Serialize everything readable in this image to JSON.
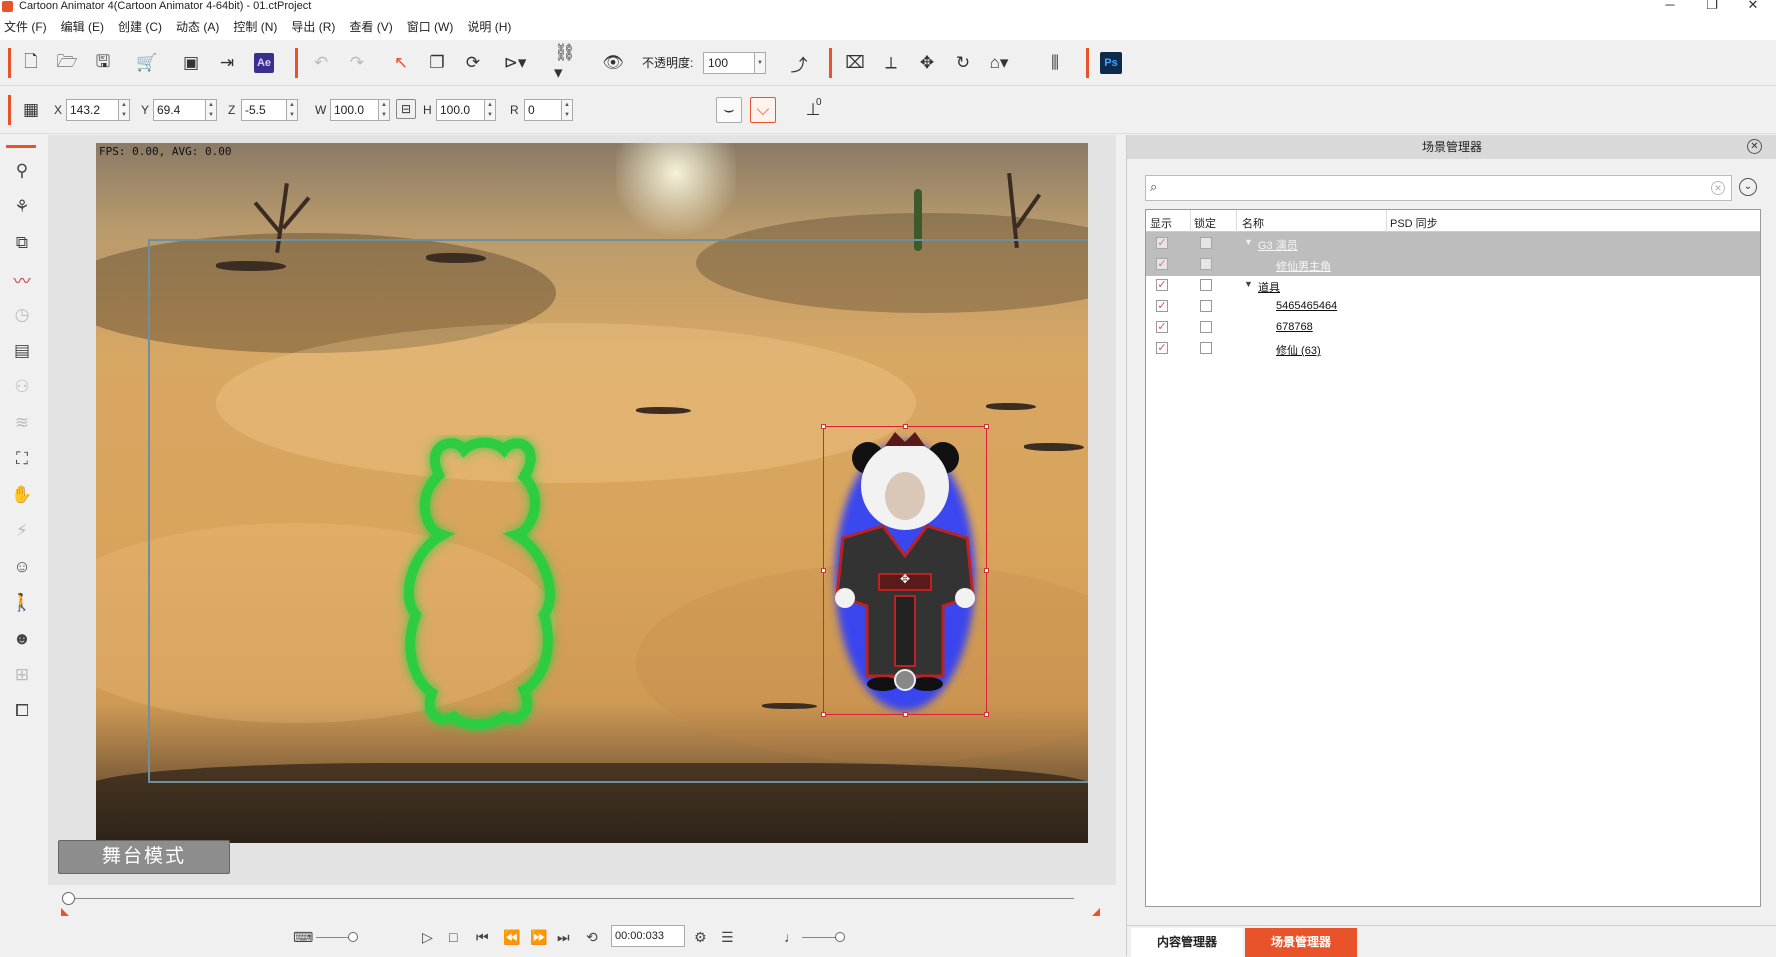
{
  "window": {
    "title": "Cartoon Animator 4(Cartoon Animator 4-64bit) - 01.ctProject",
    "minimize_glyph": "─",
    "restore_glyph": "❐",
    "close_glyph": "✕"
  },
  "menu": [
    "文件 (F)",
    "编辑 (E)",
    "创建 (C)",
    "动态 (A)",
    "控制 (N)",
    "导出 (R)",
    "查看 (V)",
    "窗口 (W)",
    "说明 (H)"
  ],
  "toolbar1": {
    "opacity_label": "不透明度:",
    "opacity_value": "100",
    "ae_label": "Ae",
    "ps_label": "Ps"
  },
  "transform": {
    "x_label": "X",
    "x_value": "143.2",
    "y_label": "Y",
    "y_value": "69.4",
    "z_label": "Z",
    "z_value": "-5.5",
    "w_label": "W",
    "w_value": "100.0",
    "h_label": "H",
    "h_value": "100.0",
    "r_label": "R",
    "r_value": "0",
    "pin_value": "0"
  },
  "viewport": {
    "fps_text": "FPS: 0.00, AVG: 0.00",
    "stage_mode_label": "舞台模式"
  },
  "timeline": {
    "timecode": "00:00:033"
  },
  "scene_manager": {
    "title": "场景管理器",
    "search_placeholder": "",
    "columns": {
      "show": "显示",
      "lock": "锁定",
      "name": "名称",
      "psd": "PSD 同步"
    },
    "rows": [
      {
        "name": "G3 演员",
        "show": true,
        "lock": false,
        "expanded": true,
        "indent": 0,
        "selected": true
      },
      {
        "name": "修仙男主角",
        "show": true,
        "lock": false,
        "indent": 1,
        "selected": true
      },
      {
        "name": "道具",
        "show": true,
        "lock": false,
        "expanded": true,
        "indent": 0,
        "selected": false
      },
      {
        "name": "5465465464",
        "show": true,
        "lock": false,
        "indent": 1,
        "selected": false
      },
      {
        "name": "678768",
        "show": true,
        "lock": false,
        "indent": 1,
        "selected": false
      },
      {
        "name": "修仙 (63)",
        "show": true,
        "lock": false,
        "indent": 1,
        "selected": false
      }
    ]
  },
  "tabs": {
    "content_manager": "内容管理器",
    "scene_manager": "场景管理器"
  },
  "colors": {
    "accent": "#e8532a",
    "selection_row": "#bdbdbd",
    "glow_green": "#2ecc40",
    "glow_blue": "#2a3cff"
  }
}
